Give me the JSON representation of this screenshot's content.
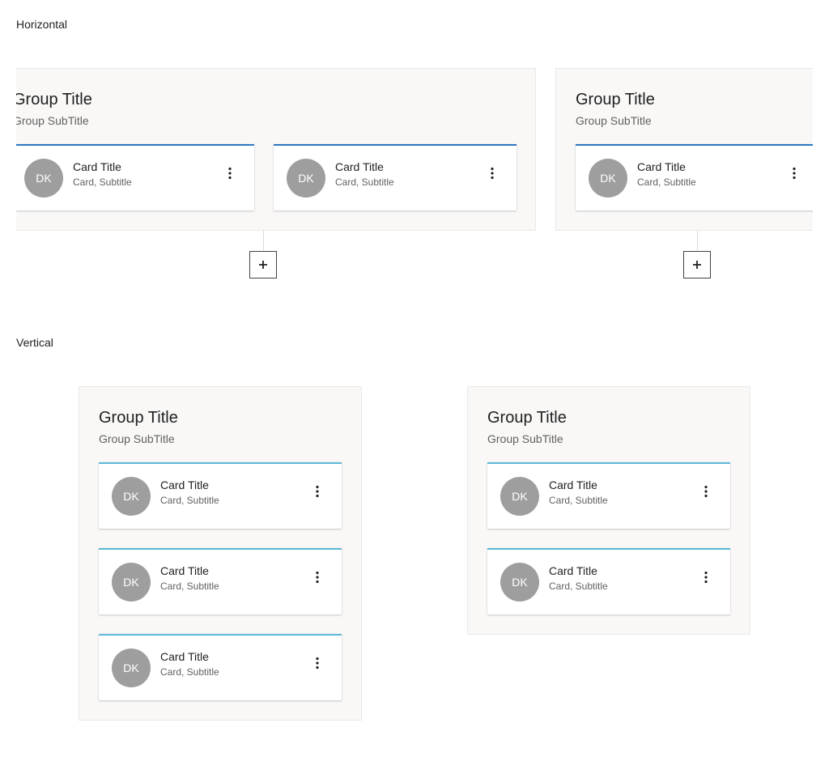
{
  "horizontal": {
    "label": "Horizontal",
    "groups": [
      {
        "title": "Group Title",
        "subtitle": "Group SubTitle",
        "cards": [
          {
            "initials": "DK",
            "title": "Card Title",
            "subtitle": "Card, Subtitle"
          },
          {
            "initials": "DK",
            "title": "Card Title",
            "subtitle": "Card, Subtitle"
          }
        ]
      },
      {
        "title": "Group Title",
        "subtitle": "Group SubTitle",
        "cards": [
          {
            "initials": "DK",
            "title": "Card Title",
            "subtitle": "Card, Subtitle"
          }
        ]
      }
    ]
  },
  "vertical": {
    "label": "Vertical",
    "groups": [
      {
        "title": "Group Title",
        "subtitle": "Group SubTitle",
        "cards": [
          {
            "initials": "DK",
            "title": "Card Title",
            "subtitle": "Card, Subtitle"
          },
          {
            "initials": "DK",
            "title": "Card Title",
            "subtitle": "Card, Subtitle"
          },
          {
            "initials": "DK",
            "title": "Card Title",
            "subtitle": "Card, Subtitle"
          }
        ]
      },
      {
        "title": "Group Title",
        "subtitle": "Group SubTitle",
        "cards": [
          {
            "initials": "DK",
            "title": "Card Title",
            "subtitle": "Card, Subtitle"
          },
          {
            "initials": "DK",
            "title": "Card Title",
            "subtitle": "Card, Subtitle"
          }
        ]
      }
    ]
  },
  "colors": {
    "horizontal_accent": "#2f77c6",
    "vertical_accent": "#5bbad6",
    "avatar": "#9e9e9e"
  },
  "icons": {
    "card_menu": "more-vert-icon",
    "add": "plus-icon"
  }
}
